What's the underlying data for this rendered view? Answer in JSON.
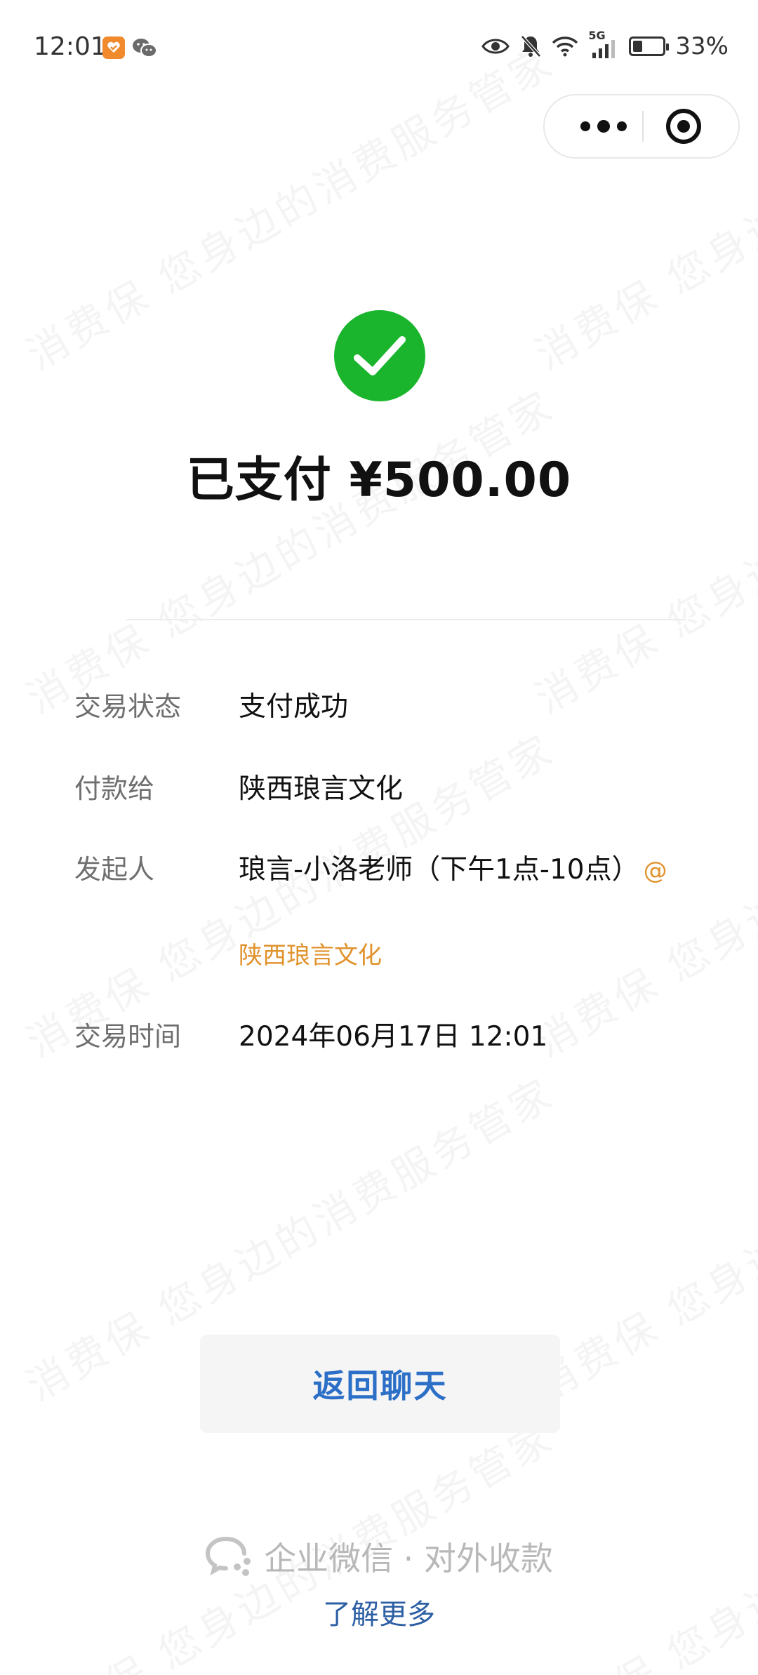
{
  "status_bar": {
    "time": "12:01",
    "network_label": "5G",
    "battery_percent": "33%",
    "battery_level": 0.33
  },
  "capsule": {
    "more_icon": "more-dots-icon",
    "close_icon": "target-close-icon"
  },
  "watermark": {
    "text": "消费保 您身边的消费服务管家"
  },
  "payment": {
    "title": "已支付 ¥500.00",
    "success_color": "#1bb52d",
    "details": [
      {
        "label": "交易状态",
        "value": "支付成功"
      },
      {
        "label": "付款给",
        "value": "陕西琅言文化"
      },
      {
        "label": "发起人",
        "value": "琅言-小洛老师（下午1点-10点）",
        "at_mark": "@",
        "org": "陕西琅言文化"
      },
      {
        "label": "交易时间",
        "value": "2024年06月17日 12:01"
      }
    ]
  },
  "actions": {
    "back_label": "返回聊天",
    "accent_color": "#2c6fc7"
  },
  "footer": {
    "brand": "企业微信 · 对外收款",
    "learn_more": "了解更多"
  }
}
